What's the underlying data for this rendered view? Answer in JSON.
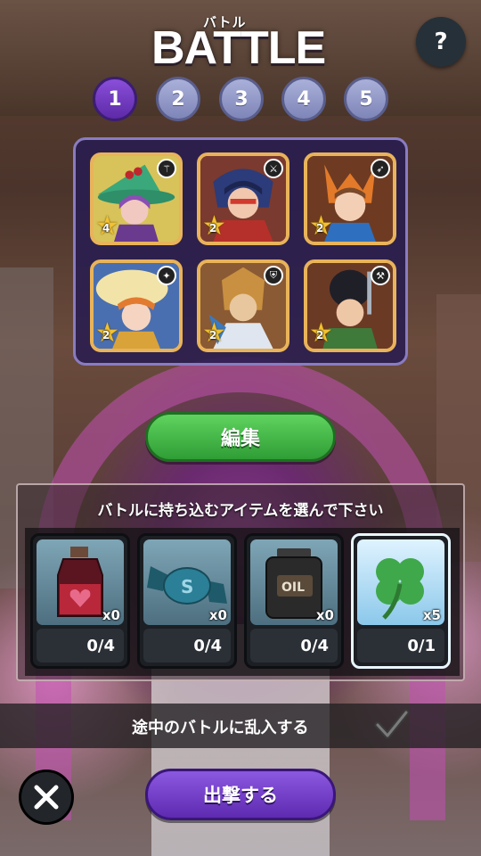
{
  "header": {
    "title": "BATTLE",
    "title_ruby": "バトル",
    "help_label": "?"
  },
  "pages": [
    {
      "label": "1",
      "active": true
    },
    {
      "label": "2",
      "active": false
    },
    {
      "label": "3",
      "active": false
    },
    {
      "label": "4",
      "active": false
    },
    {
      "label": "5",
      "active": false
    }
  ],
  "team": [
    {
      "level": "4",
      "class_icon": "staff-icon"
    },
    {
      "level": "2",
      "class_icon": "sword-icon"
    },
    {
      "level": "2",
      "class_icon": "bow-icon"
    },
    {
      "level": "2",
      "class_icon": "magic-icon"
    },
    {
      "level": "2",
      "class_icon": "shield-icon"
    },
    {
      "level": "2",
      "class_icon": "axe-icon"
    }
  ],
  "edit_button": "編集",
  "items_section": {
    "heading": "バトルに持ち込むアイテムを選んで下さい",
    "items": [
      {
        "name": "potion",
        "icon": "potion-bottle-icon",
        "count": "x0",
        "usage": "0/4",
        "selected": false
      },
      {
        "name": "candy",
        "icon": "candy-icon",
        "count": "x0",
        "usage": "0/4",
        "selected": false
      },
      {
        "name": "oil",
        "icon": "oil-can-icon",
        "count": "x0",
        "usage": "0/4",
        "selected": false,
        "can_label": "OIL"
      },
      {
        "name": "clover",
        "icon": "four-leaf-clover-icon",
        "count": "x5",
        "usage": "0/1",
        "selected": true
      }
    ]
  },
  "intrude": {
    "label": "途中のバトルに乱入する",
    "checked": true
  },
  "footer": {
    "sortie_label": "出撃する"
  },
  "colors": {
    "active_page": "#6a35bf",
    "edit_green": "#3fb23f",
    "sortie_purple": "#6e3bc6",
    "panel_bg": "#281c50"
  }
}
